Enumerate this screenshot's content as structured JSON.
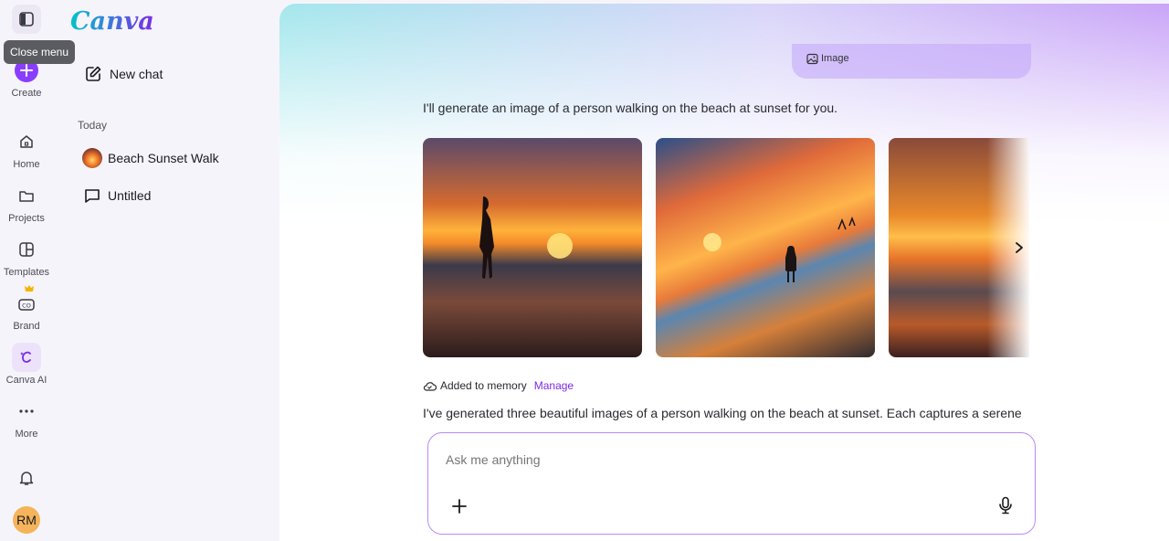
{
  "rail": {
    "tooltip": "Close menu",
    "create_label": "Create",
    "items": [
      {
        "label": "Home",
        "icon": "home-icon"
      },
      {
        "label": "Projects",
        "icon": "folder-icon"
      },
      {
        "label": "Templates",
        "icon": "templates-icon"
      },
      {
        "label": "Brand",
        "icon": "brand-icon"
      },
      {
        "label": "Canva AI",
        "icon": "canva-ai-icon"
      },
      {
        "label": "More",
        "icon": "more-icon"
      }
    ],
    "avatar_initials": "RM"
  },
  "panel": {
    "logo": "Canva",
    "new_chat": "New chat",
    "section_today": "Today",
    "history": [
      {
        "title": "Beach Sunset Walk",
        "icon": "beach-thumbnail"
      },
      {
        "title": "Untitled",
        "icon": "chat-icon"
      }
    ]
  },
  "chat": {
    "user_chip": "Image",
    "assistant_intro": "I'll generate an image of a person walking on the beach at sunset for you.",
    "memory_text": "Added to memory",
    "memory_link": "Manage",
    "summary": "I've generated three beautiful images of a person walking on the beach at sunset. Each captures a serene"
  },
  "composer": {
    "placeholder": "Ask me anything"
  },
  "colors": {
    "accent": "#8b3dff",
    "composer_border": "#b88af5"
  }
}
